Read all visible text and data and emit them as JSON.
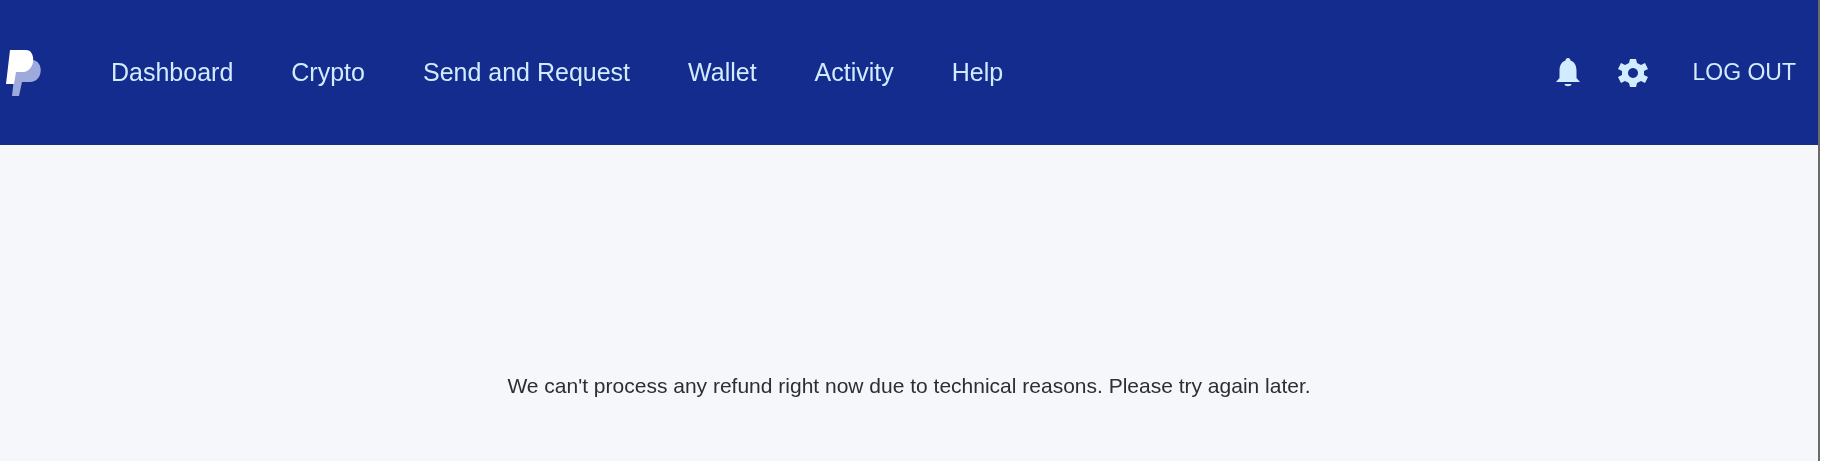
{
  "header": {
    "nav": [
      {
        "label": "Dashboard"
      },
      {
        "label": "Crypto"
      },
      {
        "label": "Send and Request"
      },
      {
        "label": "Wallet"
      },
      {
        "label": "Activity"
      },
      {
        "label": "Help"
      }
    ],
    "logout": "LOG OUT"
  },
  "message": "We can't process any refund right now due to technical reasons. Please try again later."
}
